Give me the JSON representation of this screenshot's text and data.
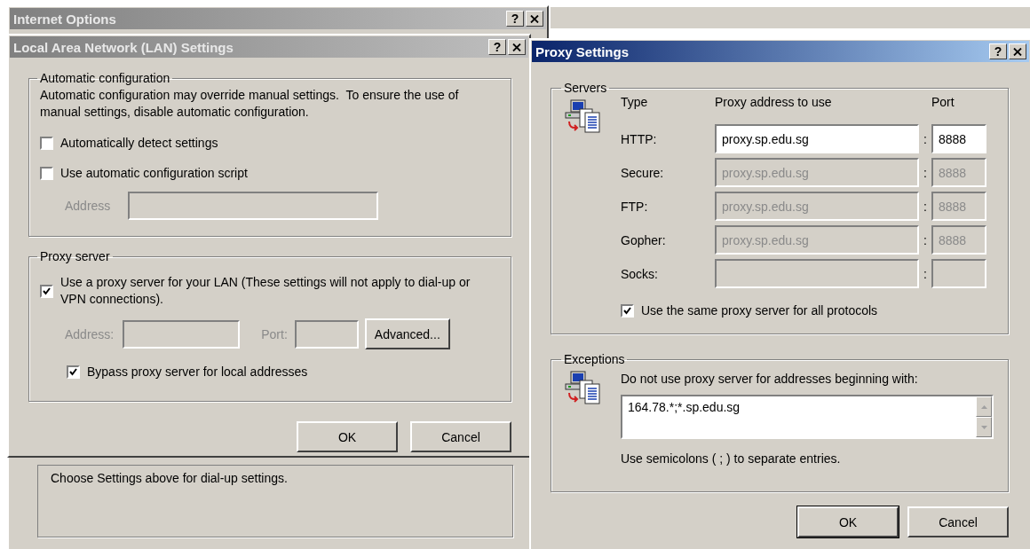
{
  "internet_options": {
    "title": "Internet Options",
    "active": false,
    "help_button": "?",
    "note": "Choose Settings above for dial-up settings."
  },
  "lan": {
    "title": "Local Area Network (LAN) Settings",
    "active": false,
    "help_button": "?",
    "auto_group": {
      "label": "Automatic configuration",
      "description": "Automatic configuration may override manual settings.  To ensure the use of manual settings, disable automatic configuration.",
      "options": [
        {
          "label": "Automatically detect settings",
          "checked": false
        },
        {
          "label": "Use automatic configuration script",
          "checked": false
        }
      ],
      "address": {
        "label": "Address",
        "disabled": true
      }
    },
    "proxy_group": {
      "label": "Proxy server",
      "use_proxy": {
        "label": "Use a proxy server for your LAN (These settings will not apply to dial-up or VPN connections).",
        "checked": true
      },
      "address": {
        "label": "Address:",
        "disabled": true
      },
      "port": {
        "label": "Port:",
        "disabled": true
      },
      "advanced_button": "Advanced...",
      "bypass": {
        "label": "Bypass proxy server for local addresses",
        "checked": true
      }
    },
    "buttons": [
      {
        "label": "OK",
        "default": false
      },
      {
        "label": "Cancel",
        "default": false
      }
    ]
  },
  "proxy": {
    "title": "Proxy Settings",
    "active": true,
    "help_button": "?",
    "servers": {
      "label": "Servers",
      "headers": [
        "Type",
        "Proxy address to use",
        "Port"
      ],
      "rows": [
        {
          "type": "HTTP:",
          "address": "proxy.sp.edu.sg",
          "colon": ":",
          "port": "8888",
          "disabled": false
        },
        {
          "type": "Secure:",
          "address": "proxy.sp.edu.sg",
          "colon": ":",
          "port": "8888",
          "disabled": true
        },
        {
          "type": "FTP:",
          "address": "proxy.sp.edu.sg",
          "colon": ":",
          "port": "8888",
          "disabled": true
        },
        {
          "type": "Gopher:",
          "address": "proxy.sp.edu.sg",
          "colon": ":",
          "port": "8888",
          "disabled": true
        },
        {
          "type": "Socks:",
          "colon": ":",
          "disabled": true
        }
      ],
      "same_for_all": {
        "label": "Use the same proxy server for all protocols",
        "checked": true
      }
    },
    "exceptions": {
      "label": "Exceptions",
      "prompt": "Do not use proxy server for addresses beginning with:",
      "value": "164.78.*;*.sp.edu.sg",
      "hint": "Use semicolons ( ; ) to separate entries."
    },
    "buttons": [
      {
        "label": "OK",
        "default": true
      },
      {
        "label": "Cancel",
        "default": false
      }
    ]
  }
}
